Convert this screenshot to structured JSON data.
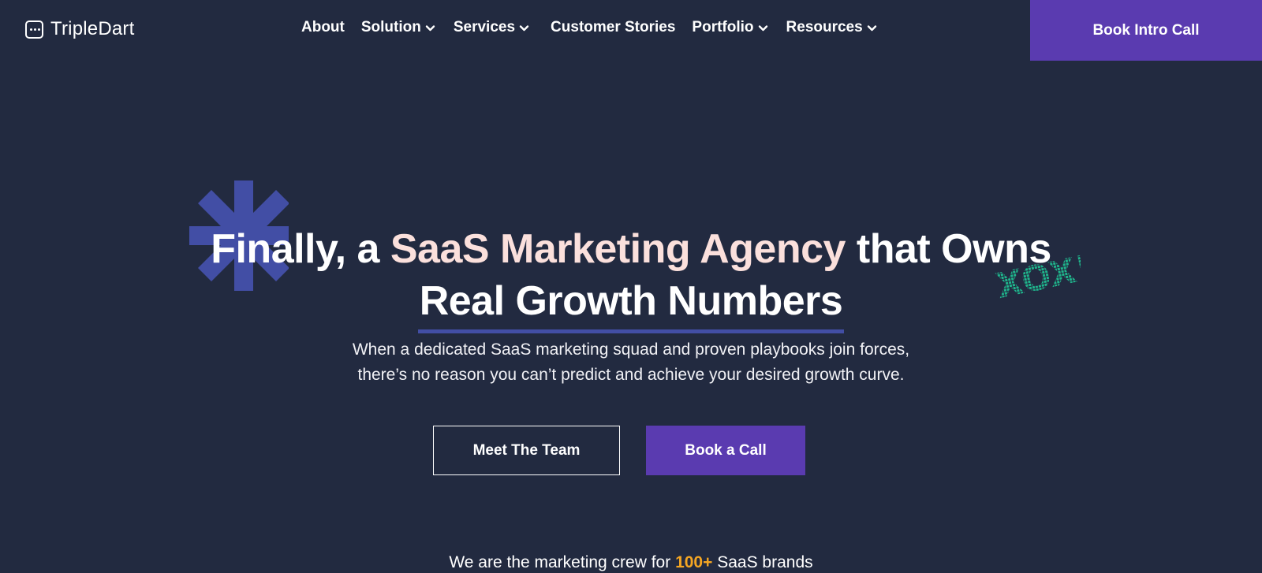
{
  "brand": {
    "name": "TripleDart",
    "logo_icon": "chat-dots-icon"
  },
  "nav": {
    "items": [
      {
        "label": "About",
        "has_dropdown": false
      },
      {
        "label": "Solution",
        "has_dropdown": true
      },
      {
        "label": "Services",
        "has_dropdown": true
      },
      {
        "label": "Customer Stories",
        "has_dropdown": false
      },
      {
        "label": "Portfolio",
        "has_dropdown": true
      },
      {
        "label": "Resources",
        "has_dropdown": true
      }
    ],
    "cta_label": "Book Intro Call"
  },
  "hero": {
    "title_part1": "Finally, a ",
    "title_accent": "SaaS Marketing Agency",
    "title_part2": " that Owns",
    "title_line2": "Real Growth Numbers",
    "subtitle_line1": "When a dedicated SaaS marketing squad and proven playbooks join forces,",
    "subtitle_line2": "there’s no reason you can’t predict and achieve your desired growth curve.",
    "primary_button": "Meet The Team",
    "secondary_button": "Book a Call"
  },
  "bottom": {
    "text_before": "We are the marketing crew for ",
    "number": "100+",
    "text_after": " SaaS brands"
  },
  "colors": {
    "background": "#222a40",
    "accent_purple": "#5a3bb0",
    "title_accent": "#fbe0dc",
    "underline": "#424ea5",
    "asterisk": "#424ea5",
    "xo_green": "#1fb58c",
    "number_orange": "#f5a623"
  }
}
